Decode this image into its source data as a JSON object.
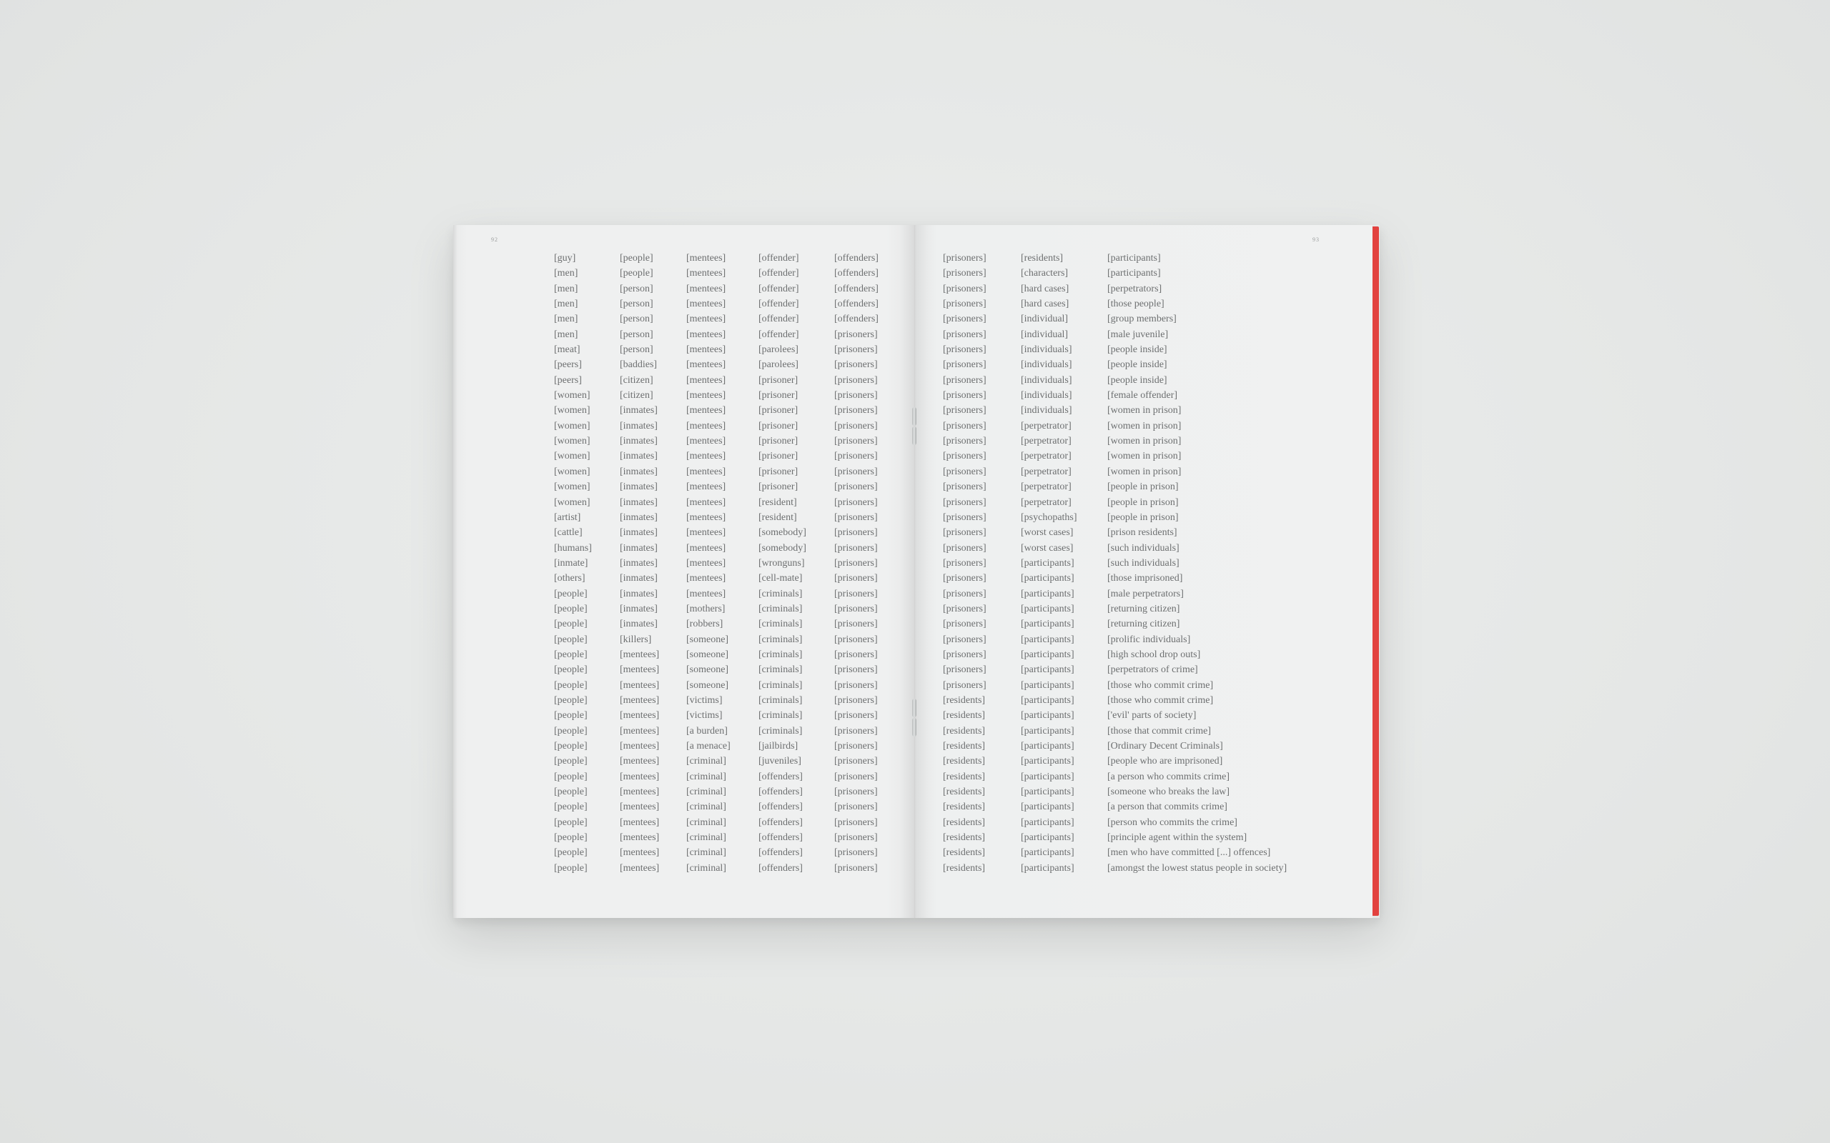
{
  "pages": {
    "left_number": "92",
    "right_number": "93"
  },
  "columns": {
    "c1": [
      "[guy]",
      "[men]",
      "[men]",
      "[men]",
      "[men]",
      "[men]",
      "[meat]",
      "[peers]",
      "[peers]",
      "[women]",
      "[women]",
      "[women]",
      "[women]",
      "[women]",
      "[women]",
      "[women]",
      "[women]",
      "[artist]",
      "[cattle]",
      "[humans]",
      "[inmate]",
      "[others]",
      "[people]",
      "[people]",
      "[people]",
      "[people]",
      "[people]",
      "[people]",
      "[people]",
      "[people]",
      "[people]",
      "[people]",
      "[people]",
      "[people]",
      "[people]",
      "[people]",
      "[people]",
      "[people]",
      "[people]",
      "[people]",
      "[people]"
    ],
    "c2": [
      "[people]",
      "[people]",
      "[person]",
      "[person]",
      "[person]",
      "[person]",
      "[person]",
      "[baddies]",
      "[citizen]",
      "[citizen]",
      "[inmates]",
      "[inmates]",
      "[inmates]",
      "[inmates]",
      "[inmates]",
      "[inmates]",
      "[inmates]",
      "[inmates]",
      "[inmates]",
      "[inmates]",
      "[inmates]",
      "[inmates]",
      "[inmates]",
      "[inmates]",
      "[inmates]",
      "[killers]",
      "[mentees]",
      "[mentees]",
      "[mentees]",
      "[mentees]",
      "[mentees]",
      "[mentees]",
      "[mentees]",
      "[mentees]",
      "[mentees]",
      "[mentees]",
      "[mentees]",
      "[mentees]",
      "[mentees]",
      "[mentees]",
      "[mentees]"
    ],
    "c3": [
      "[mentees]",
      "[mentees]",
      "[mentees]",
      "[mentees]",
      "[mentees]",
      "[mentees]",
      "[mentees]",
      "[mentees]",
      "[mentees]",
      "[mentees]",
      "[mentees]",
      "[mentees]",
      "[mentees]",
      "[mentees]",
      "[mentees]",
      "[mentees]",
      "[mentees]",
      "[mentees]",
      "[mentees]",
      "[mentees]",
      "[mentees]",
      "[mentees]",
      "[mentees]",
      "[mothers]",
      "[robbers]",
      "[someone]",
      "[someone]",
      "[someone]",
      "[someone]",
      "[victims]",
      "[victims]",
      "[a burden]",
      "[a menace]",
      "[criminal]",
      "[criminal]",
      "[criminal]",
      "[criminal]",
      "[criminal]",
      "[criminal]",
      "[criminal]",
      "[criminal]"
    ],
    "c4": [
      "[offender]",
      "[offender]",
      "[offender]",
      "[offender]",
      "[offender]",
      "[offender]",
      "[parolees]",
      "[parolees]",
      "[prisoner]",
      "[prisoner]",
      "[prisoner]",
      "[prisoner]",
      "[prisoner]",
      "[prisoner]",
      "[prisoner]",
      "[prisoner]",
      "[resident]",
      "[resident]",
      "[somebody]",
      "[somebody]",
      "[wronguns]",
      "[cell-mate]",
      "[criminals]",
      "[criminals]",
      "[criminals]",
      "[criminals]",
      "[criminals]",
      "[criminals]",
      "[criminals]",
      "[criminals]",
      "[criminals]",
      "[criminals]",
      "[jailbirds]",
      "[juveniles]",
      "[offenders]",
      "[offenders]",
      "[offenders]",
      "[offenders]",
      "[offenders]",
      "[offenders]",
      "[offenders]"
    ],
    "c5": [
      "[offenders]",
      "[offenders]",
      "[offenders]",
      "[offenders]",
      "[offenders]",
      "[prisoners]",
      "[prisoners]",
      "[prisoners]",
      "[prisoners]",
      "[prisoners]",
      "[prisoners]",
      "[prisoners]",
      "[prisoners]",
      "[prisoners]",
      "[prisoners]",
      "[prisoners]",
      "[prisoners]",
      "[prisoners]",
      "[prisoners]",
      "[prisoners]",
      "[prisoners]",
      "[prisoners]",
      "[prisoners]",
      "[prisoners]",
      "[prisoners]",
      "[prisoners]",
      "[prisoners]",
      "[prisoners]",
      "[prisoners]",
      "[prisoners]",
      "[prisoners]",
      "[prisoners]",
      "[prisoners]",
      "[prisoners]",
      "[prisoners]",
      "[prisoners]",
      "[prisoners]",
      "[prisoners]",
      "[prisoners]",
      "[prisoners]",
      "[prisoners]"
    ],
    "c6": [
      "[prisoners]",
      "[prisoners]",
      "[prisoners]",
      "[prisoners]",
      "[prisoners]",
      "[prisoners]",
      "[prisoners]",
      "[prisoners]",
      "[prisoners]",
      "[prisoners]",
      "[prisoners]",
      "[prisoners]",
      "[prisoners]",
      "[prisoners]",
      "[prisoners]",
      "[prisoners]",
      "[prisoners]",
      "[prisoners]",
      "[prisoners]",
      "[prisoners]",
      "[prisoners]",
      "[prisoners]",
      "[prisoners]",
      "[prisoners]",
      "[prisoners]",
      "[prisoners]",
      "[prisoners]",
      "[prisoners]",
      "[prisoners]",
      "[residents]",
      "[residents]",
      "[residents]",
      "[residents]",
      "[residents]",
      "[residents]",
      "[residents]",
      "[residents]",
      "[residents]",
      "[residents]",
      "[residents]",
      "[residents]"
    ],
    "c7": [
      "[residents]",
      "[characters]",
      "[hard cases]",
      "[hard cases]",
      "[individual]",
      "[individual]",
      "[individuals]",
      "[individuals]",
      "[individuals]",
      "[individuals]",
      "[individuals]",
      "[perpetrator]",
      "[perpetrator]",
      "[perpetrator]",
      "[perpetrator]",
      "[perpetrator]",
      "[perpetrator]",
      "[psychopaths]",
      "[worst cases]",
      "[worst cases]",
      "[participants]",
      "[participants]",
      "[participants]",
      "[participants]",
      "[participants]",
      "[participants]",
      "[participants]",
      "[participants]",
      "[participants]",
      "[participants]",
      "[participants]",
      "[participants]",
      "[participants]",
      "[participants]",
      "[participants]",
      "[participants]",
      "[participants]",
      "[participants]",
      "[participants]",
      "[participants]",
      "[participants]"
    ],
    "c8": [
      "[participants]",
      "[participants]",
      "[perpetrators]",
      "[those people]",
      "[group members]",
      "[male juvenile]",
      "[people inside]",
      "[people inside]",
      "[people inside]",
      "[female offender]",
      "[women in prison]",
      "[women in prison]",
      "[women in prison]",
      "[women in prison]",
      "[women in prison]",
      "[people in prison]",
      "[people in prison]",
      "[people in prison]",
      "[prison residents]",
      "[such individuals]",
      "[such individuals]",
      "[those imprisoned]",
      "[male perpetrators]",
      "[returning citizen]",
      "[returning citizen]",
      "[prolific individuals]",
      "[high school drop outs]",
      "[perpetrators of crime]",
      "[those who commit crime]",
      "[those who commit crime]",
      "['evil' parts of society]",
      "[those that commit crime]",
      "[Ordinary Decent Criminals]",
      "[people who are imprisoned]",
      "[a person who commits crime]",
      "[someone who breaks the law]",
      "[a person that commits crime]",
      "[person who commits the crime]",
      "[principle agent within the system]",
      "[men who have committed [...] offences]",
      "[amongst the lowest status people in society]"
    ]
  },
  "colors": {
    "background": "#e6e8e7",
    "paper": "#eff0f0",
    "text": "#6d6f70",
    "cover_edge": "#e2423f"
  }
}
